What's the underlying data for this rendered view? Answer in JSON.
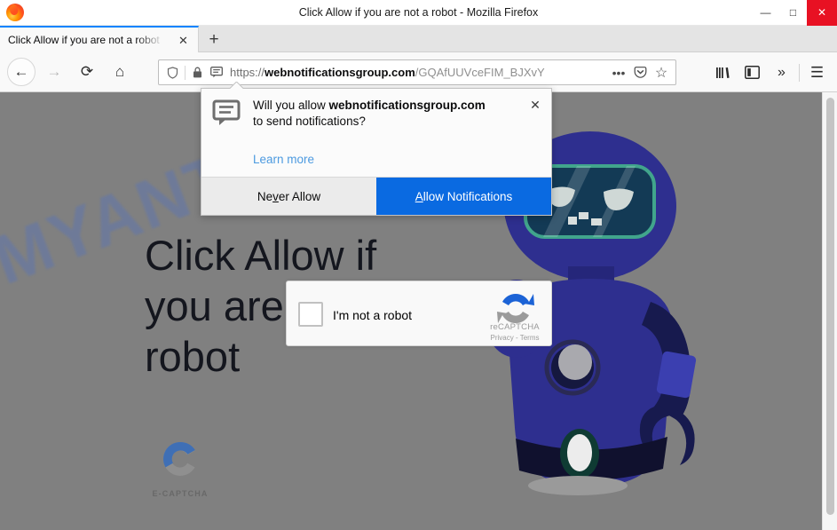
{
  "window": {
    "title": "Click Allow if you are not a robot - Mozilla Firefox",
    "minimize": "—",
    "maximize": "□",
    "close": "✕",
    "logo_icon": "firefox-logo"
  },
  "tabs": {
    "items": [
      {
        "label": "Click Allow if you are not a robot",
        "close_icon": "✕"
      }
    ],
    "new_tab_icon": "+"
  },
  "toolbar": {
    "back_icon": "←",
    "forward_icon": "→",
    "reload_icon": "⟳",
    "home_icon": "⌂",
    "library_icon": "library-icon",
    "sidebar_icon": "sidebar-icon",
    "overflow_icon": "»",
    "menu_icon": "☰"
  },
  "urlbar": {
    "shield_icon": "shield-icon",
    "lock_icon": "lock-icon",
    "notification_permission_icon": "speech-bubble-icon",
    "scheme": "https://",
    "domain": "webnotificationsgroup.com",
    "path": "/GQAfUUVceFIM_BJXvY",
    "page_actions_icon": "•••",
    "pocket_icon": "pocket-icon",
    "bookmark_icon": "☆"
  },
  "doorhanger": {
    "icon": "notification-bubble-icon",
    "question_prefix": "Will you allow ",
    "question_domain": "webnotificationsgroup.com",
    "question_suffix": " to send notifications?",
    "learn_more": "Learn more",
    "close_icon": "✕",
    "never_allow": "Never Allow",
    "allow": "Allow Notifications",
    "accent_color": "#0a6ae1"
  },
  "page": {
    "background_color": "#808080",
    "watermark": "MYANTISPYWARE.COM",
    "headline": "Click Allow if you are robot",
    "headline_lines": [
      "Click Allow if",
      "you are",
      "robot"
    ],
    "ecaptcha": {
      "logo_icon": "e-captcha-c-logo",
      "label": "E-CAPTCHA",
      "blue": "#3f6fb5",
      "gray": "#8f8f8f"
    },
    "recaptcha": {
      "checkbox_icon": "unchecked-checkbox",
      "label": "I'm not a robot",
      "brand": "reCAPTCHA",
      "terms": "Privacy - Terms",
      "logo_icon": "recaptcha-logo"
    },
    "robot": {
      "icon": "robot-illustration",
      "body_color": "#2e2f8f",
      "visor_color": "#133a55",
      "visor_border": "#41a58c"
    }
  },
  "scrollbar": {
    "thumb_icon": "vertical-scrollbar-thumb"
  }
}
